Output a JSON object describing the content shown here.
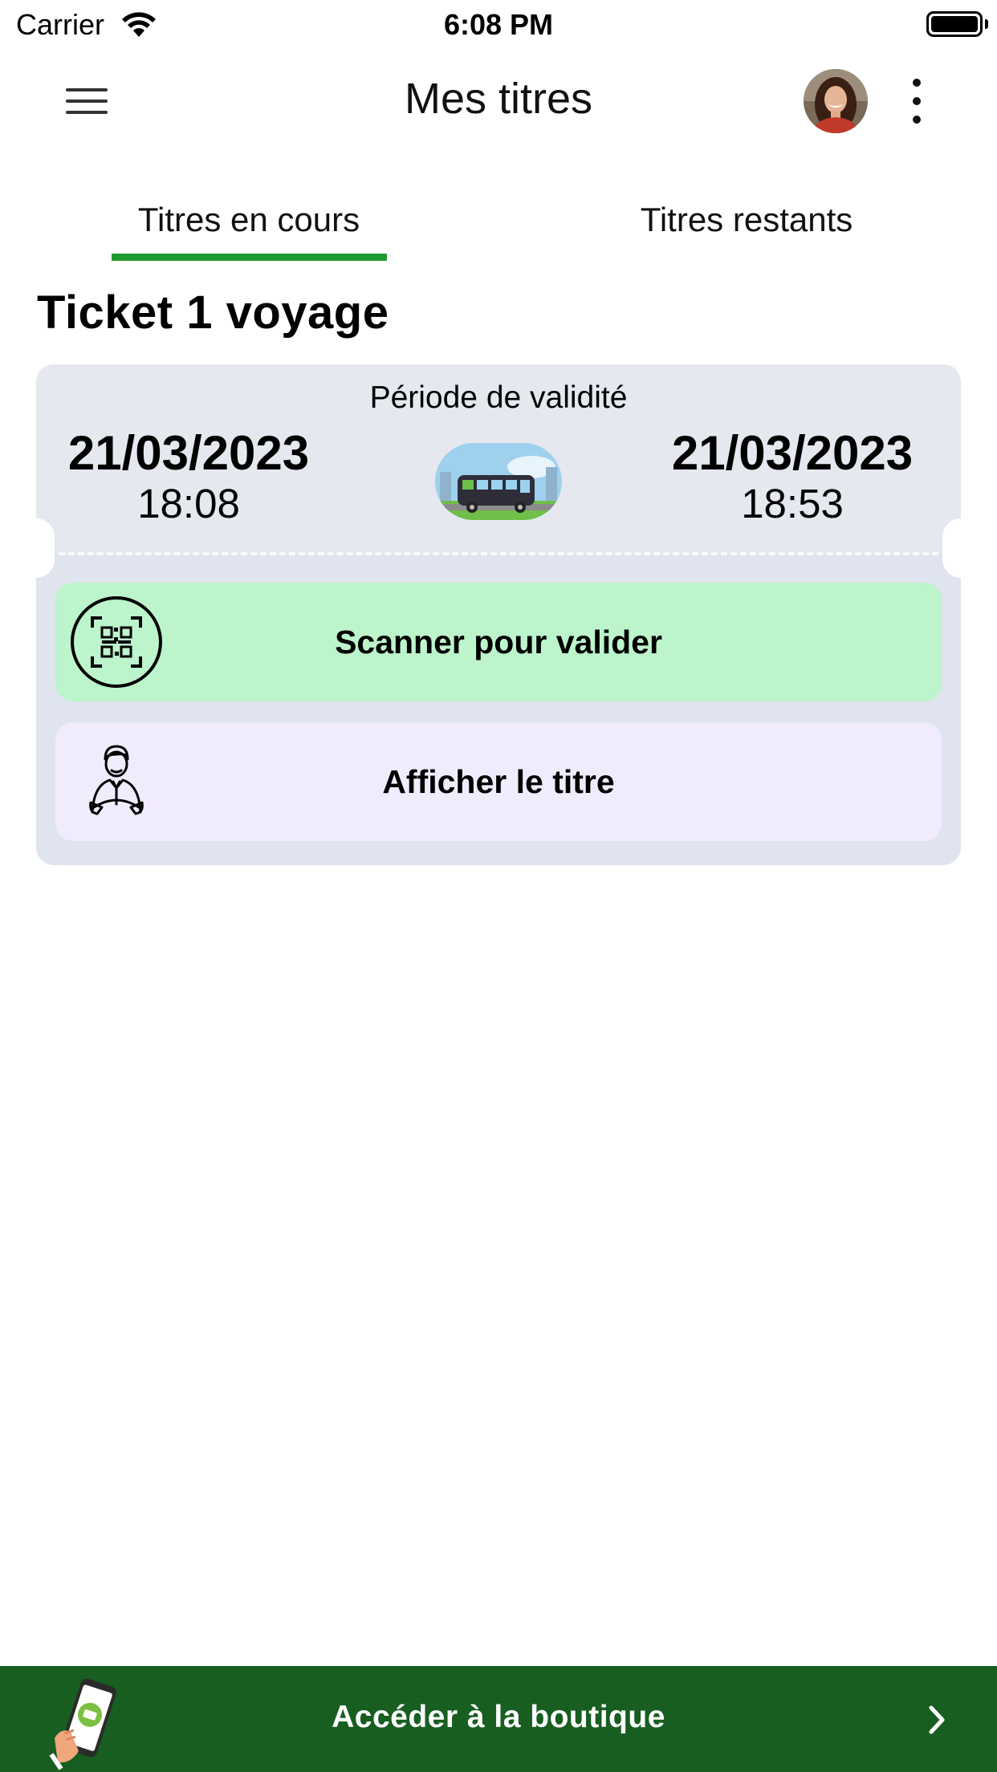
{
  "status_bar": {
    "carrier": "Carrier",
    "time": "6:08 PM"
  },
  "app_bar": {
    "title": "Mes titres",
    "menu_icon": "hamburger-menu-icon",
    "profile_icon": "avatar",
    "more_icon": "more-vertical-icon"
  },
  "tabs": [
    {
      "label": "Titres en cours",
      "active": true
    },
    {
      "label": "Titres restants",
      "active": false
    }
  ],
  "ticket": {
    "title": "Ticket 1 voyage",
    "validity_label": "Période de validité",
    "start": {
      "date": "21/03/2023",
      "time": "18:08"
    },
    "end": {
      "date": "21/03/2023",
      "time": "18:53"
    },
    "transport_icon": "bus-icon",
    "actions": {
      "scan": {
        "label": "Scanner pour valider",
        "icon": "qr-scan-icon"
      },
      "show": {
        "label": "Afficher le titre",
        "icon": "driver-icon"
      }
    }
  },
  "shop_bar": {
    "label": "Accéder à la boutique",
    "icon": "phone-ticket-icon",
    "chevron": "chevron-right-icon"
  },
  "colors": {
    "accent": "#1f9a2e",
    "shop_bar_bg": "#175e20",
    "scan_button_bg": "#bcf4cb",
    "show_button_bg": "#f1ecfd",
    "ticket_bg": "#dfe4ee"
  }
}
